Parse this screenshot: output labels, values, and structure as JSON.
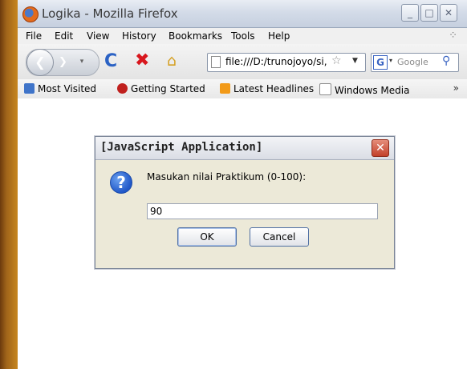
{
  "browser": {
    "title": "Logika - Mozilla Firefox",
    "menu": [
      {
        "label": "File"
      },
      {
        "label": "Edit"
      },
      {
        "label": "View"
      },
      {
        "label": "History"
      },
      {
        "label": "Bookmarks"
      },
      {
        "label": "Tools"
      },
      {
        "label": "Help"
      }
    ],
    "url": "file:///D:/trunojoyo/si,",
    "search_placeholder": "Google",
    "bookmarks": [
      {
        "label": "Most Visited"
      },
      {
        "label": "Getting Started"
      },
      {
        "label": "Latest Headlines"
      },
      {
        "label": "Windows Media"
      }
    ],
    "overflow": "»"
  },
  "dialog": {
    "title": "[JavaScript Application]",
    "prompt": "Masukan nilai Praktikum (0-100):",
    "value": "90",
    "ok_label": "OK",
    "cancel_label": "Cancel"
  }
}
